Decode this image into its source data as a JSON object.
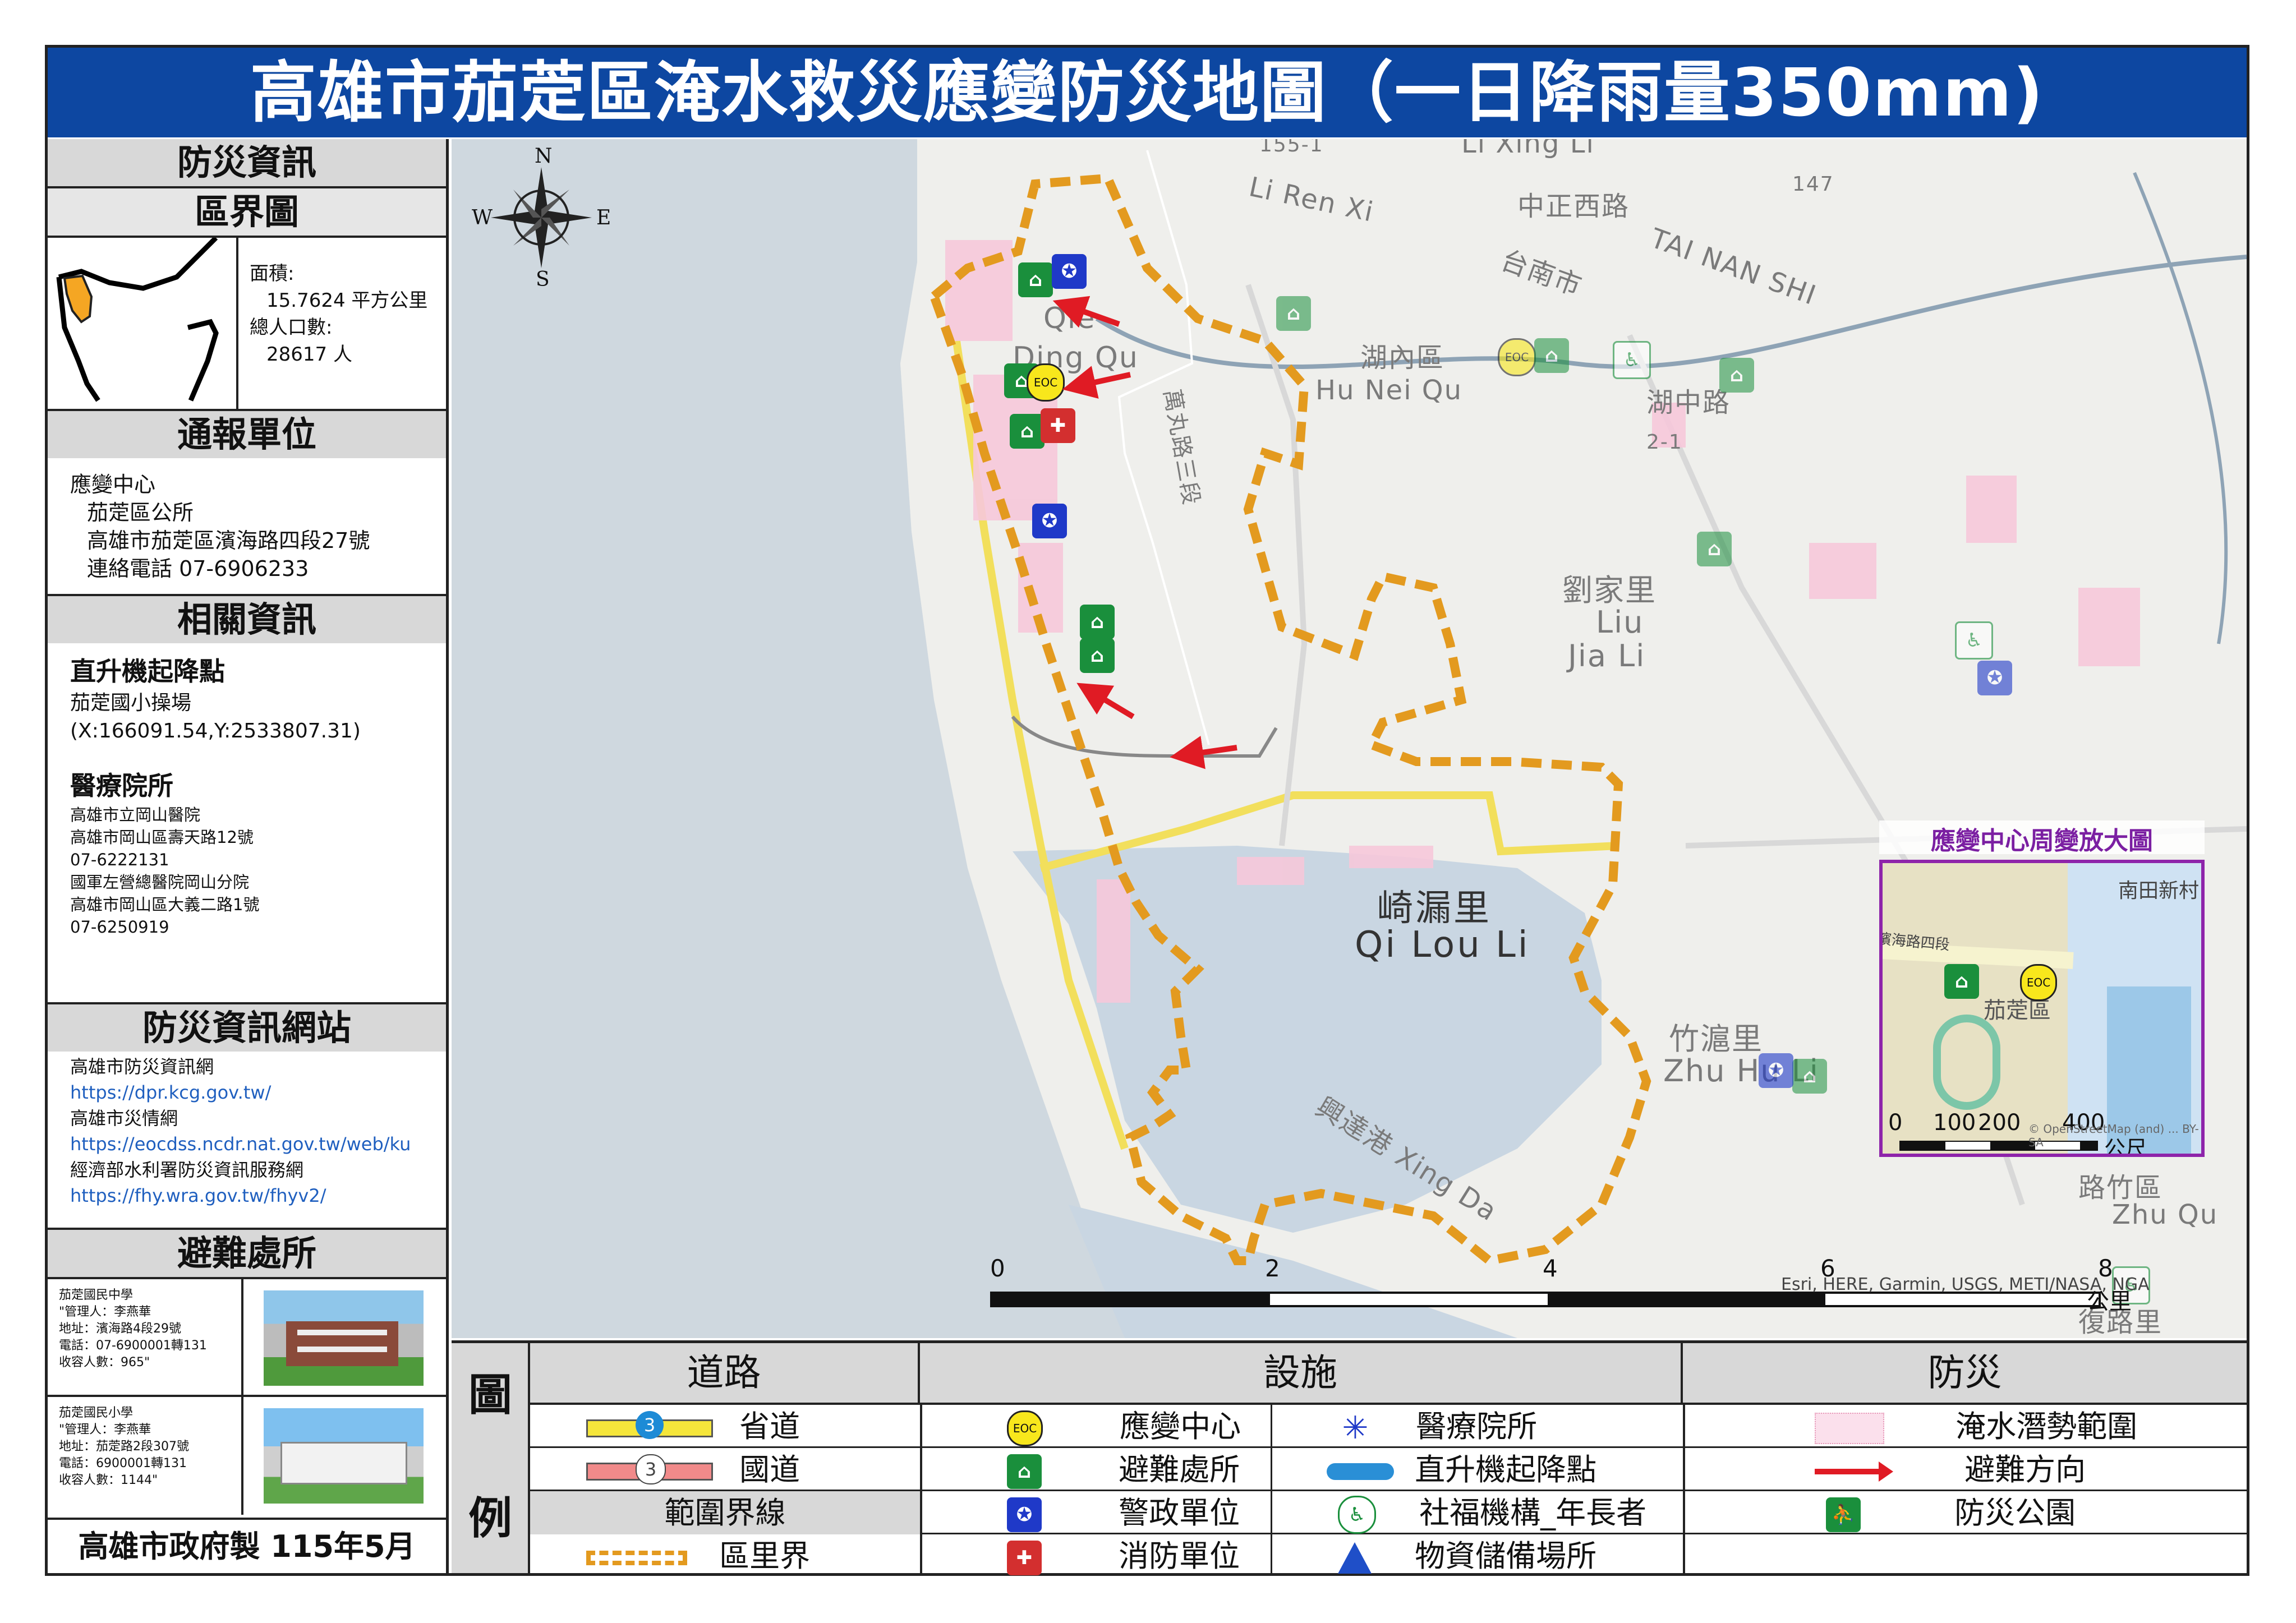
{
  "title": "高雄市茄萣區淹水救災應變防災地圖（一日降雨量350mm)",
  "sidebar": {
    "info_heading": "防災資訊",
    "boundary_heading": "區界圖",
    "area_label": "面積:",
    "area_value": "15.7624 平方公里",
    "pop_label": "總人口數:",
    "pop_value": "28617 人",
    "report_heading": "通報單位",
    "report_lines": [
      "應變中心",
      "茄萣區公所",
      "高雄市茄萣區濱海路四段27號",
      "連絡電話 07-6906233"
    ],
    "related_heading": "相關資訊",
    "heli_title": "直升機起降點",
    "heli_lines": [
      "茄萣國小操場",
      "(X:166091.54,Y:2533807.31)"
    ],
    "medical_title": "醫療院所",
    "medical_lines": [
      "高雄市立岡山醫院",
      "高雄市岡山區壽天路12號",
      "07-6222131",
      "國軍左營總醫院岡山分院",
      "高雄市岡山區大義二路1號",
      "07-6250919"
    ],
    "web_heading": "防災資訊網站",
    "web_lines": [
      {
        "text": "高雄市防災資訊網",
        "link": false
      },
      {
        "text": "https://dpr.kcg.gov.tw/",
        "link": true
      },
      {
        "text": "高雄市災情網",
        "link": false
      },
      {
        "text": "https://eocdss.ncdr.nat.gov.tw/web/ku",
        "link": true
      },
      {
        "text": "經濟部水利署防災資訊服務網",
        "link": false
      },
      {
        "text": "https://fhy.wra.gov.tw/fhyv2/",
        "link": true
      }
    ],
    "shelter_heading": "避難處所",
    "shelters": [
      {
        "lines": [
          "茄萣國民中學",
          "\"管理人：李燕華",
          "地址：濱海路4段29號",
          "電話：07-6900001轉131",
          "收容人數：965\""
        ]
      },
      {
        "lines": [
          "茄萣國民小學",
          "\"管理人：李燕華",
          "地址：茄萣路2段307號",
          "電話：6900001轉131",
          "收容人數：1144\""
        ]
      }
    ],
    "footer": "高雄市政府製 115年5月"
  },
  "map": {
    "compass": {
      "n": "N",
      "s": "S",
      "e": "E",
      "w": "W"
    },
    "labels": [
      {
        "text": "中正西路"
      },
      {
        "text": "台南市"
      },
      {
        "text": "TAI NAN SHI"
      },
      {
        "text": "湖內區"
      },
      {
        "text": "Hu Nei Qu"
      },
      {
        "text": "湖中路"
      },
      {
        "text": "劉家里"
      },
      {
        "text": "Liu"
      },
      {
        "text": "Jia Li"
      },
      {
        "text": "崎漏里"
      },
      {
        "text": "Qi Lou Li"
      },
      {
        "text": "竹滬里"
      },
      {
        "text": "Zhu Hu Li"
      },
      {
        "text": "興達港 Xing Da"
      },
      {
        "text": "Qie"
      },
      {
        "text": "Ding Qu"
      },
      {
        "text": "萬丸路三段"
      },
      {
        "text": "147"
      },
      {
        "text": "2-1"
      },
      {
        "text": "155-1"
      },
      {
        "text": "Li Xing Li"
      },
      {
        "text": "Li Ren Xi"
      },
      {
        "text": "路竹區"
      },
      {
        "text": "Zhu Qu"
      },
      {
        "text": "復路里"
      }
    ],
    "scale_ticks": [
      "0",
      "2",
      "4",
      "6",
      "8"
    ],
    "scale_unit": "公里",
    "attribution": "Esri, HERE, Garmin, USGS, METI/NASA, NGA",
    "inset": {
      "title": "應變中心周變放大圖",
      "place": "南田新村",
      "district": "茄萣區",
      "road": "濱海路四段",
      "ticks": [
        "0",
        "100",
        "200",
        "400"
      ],
      "unit": "公尺",
      "credit": "© OpenStreetMap (and) ... BY-SA"
    },
    "eoc_text": "EOC"
  },
  "legend": {
    "side_chars": [
      "圖",
      "例"
    ],
    "road_heading": "道路",
    "facility_heading": "設施",
    "disaster_heading": "防災",
    "roads": {
      "provincial": "省道",
      "national": "國道",
      "boundary_heading": "範圍界線",
      "village": "區里界"
    },
    "facilities": {
      "eoc": "應變中心",
      "shelter": "避難處所",
      "police": "警政單位",
      "fire": "消防單位",
      "medical": "醫療院所",
      "helipad": "直升機起降點",
      "welfare": "社福機構_年長者",
      "storage": "物資儲備場所"
    },
    "disaster": {
      "flood": "淹水潛勢範圍",
      "direction": "避難方向",
      "park": "防災公園"
    },
    "shield_provincial": "3",
    "shield_national": "3"
  }
}
